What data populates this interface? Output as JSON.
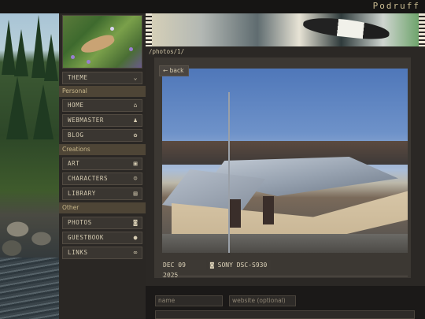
{
  "site": {
    "title": "Podruff"
  },
  "nav": {
    "theme": {
      "label": "THEME",
      "icon": "chevron-down-icon"
    },
    "sections": [
      {
        "label": "Personal",
        "items": [
          {
            "label": "HOME",
            "icon": "home-icon"
          },
          {
            "label": "WEBMASTER",
            "icon": "bell-icon"
          },
          {
            "label": "BLOG",
            "icon": "flower-icon"
          }
        ]
      },
      {
        "label": "Creations",
        "items": [
          {
            "label": "ART",
            "icon": "image-icon"
          },
          {
            "label": "CHARACTERS",
            "icon": "users-icon"
          },
          {
            "label": "LIBRARY",
            "icon": "book-icon"
          }
        ]
      },
      {
        "label": "Other",
        "items": [
          {
            "label": "PHOTOS",
            "icon": "camera-icon"
          },
          {
            "label": "GUESTBOOK",
            "icon": "comment-icon"
          },
          {
            "label": "LINKS",
            "icon": "link-icon"
          }
        ]
      }
    ]
  },
  "main": {
    "path": "/photos/1/",
    "back_label": "← back",
    "photo_date": "DEC 09 2025",
    "camera": "SONY DSC-S930"
  },
  "comment_form": {
    "name_placeholder": "name",
    "website_placeholder": "website (optional)"
  }
}
